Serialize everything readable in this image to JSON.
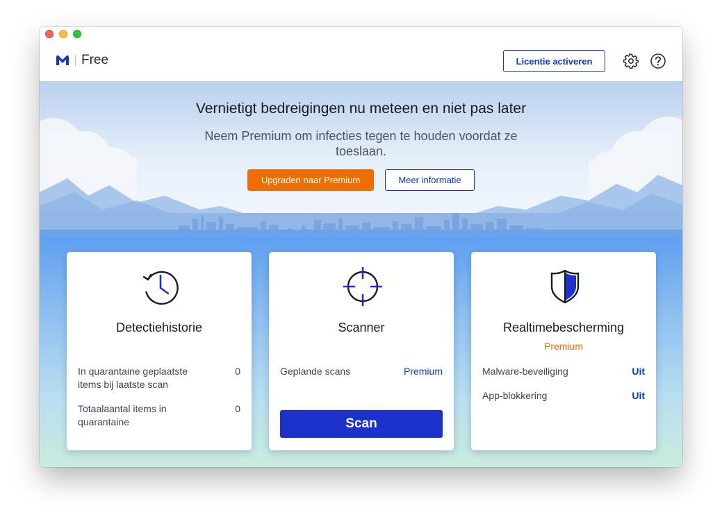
{
  "header": {
    "edition": "Free",
    "license_button": "Licentie activeren"
  },
  "hero": {
    "title": "Vernietigt bedreigingen nu meteen en niet pas later",
    "subtitle": "Neem Premium om infecties tegen te houden voordat ze toeslaan.",
    "upgrade_button": "Upgraden naar Premium",
    "info_button": "Meer informatie"
  },
  "cards": {
    "history": {
      "title": "Detectiehistorie",
      "rows": [
        {
          "label": "In quarantaine geplaatste items bij laatste scan",
          "value": "0"
        },
        {
          "label": "Totaalaantal items in quarantaine",
          "value": "0"
        }
      ]
    },
    "scanner": {
      "title": "Scanner",
      "rows": [
        {
          "label": "Geplande scans",
          "value": "Premium"
        }
      ],
      "scan_button": "Scan"
    },
    "realtime": {
      "title": "Realtimebescherming",
      "subtitle": "Premium",
      "rows": [
        {
          "label": "Malware-beveiliging",
          "value": "Uit"
        },
        {
          "label": "App-blokkering",
          "value": "Uit"
        }
      ]
    }
  },
  "colors": {
    "accent": "#0d3bb5",
    "upgrade": "#ef6c00",
    "scan_button": "#1a32c9"
  },
  "icons": [
    "malwarebytes-logo",
    "gear-icon",
    "help-icon",
    "history-clock-icon",
    "crosshair-icon",
    "shield-icon"
  ]
}
